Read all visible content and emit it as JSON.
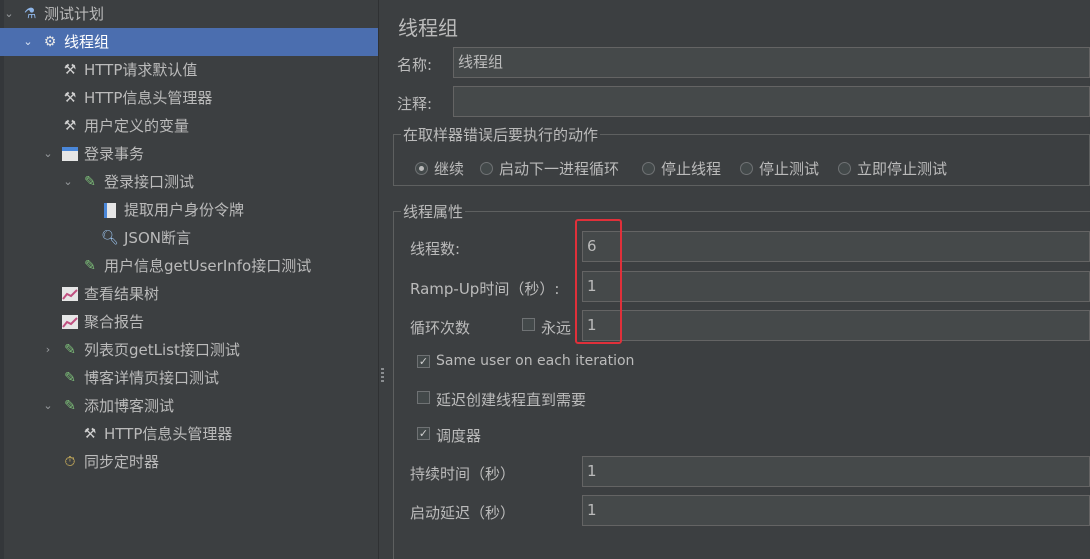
{
  "tree": {
    "items": [
      {
        "label": "测试计划",
        "icon": "flask-icon",
        "expanded": true
      },
      {
        "label": "线程组",
        "icon": "gear-icon",
        "expanded": true,
        "selected": true
      },
      {
        "label": "HTTP请求默认值",
        "icon": "wrench-icon"
      },
      {
        "label": "HTTP信息头管理器",
        "icon": "wrench-icon"
      },
      {
        "label": "用户定义的变量",
        "icon": "wrench-icon"
      },
      {
        "label": "登录事务",
        "icon": "transaction-icon",
        "expanded": true
      },
      {
        "label": "登录接口测试",
        "icon": "pipette-icon",
        "expanded": true
      },
      {
        "label": "提取用户身份令牌",
        "icon": "extractor-icon"
      },
      {
        "label": "JSON断言",
        "icon": "magnifier-icon"
      },
      {
        "label": "用户信息getUserInfo接口测试",
        "icon": "pipette-icon"
      },
      {
        "label": "查看结果树",
        "icon": "graph-icon"
      },
      {
        "label": "聚合报告",
        "icon": "graph-icon"
      },
      {
        "label": "列表页getList接口测试",
        "icon": "pipette-icon",
        "expanded": false
      },
      {
        "label": "博客详情页接口测试",
        "icon": "pipette-icon"
      },
      {
        "label": "添加博客测试",
        "icon": "pipette-icon",
        "expanded": true
      },
      {
        "label": "HTTP信息头管理器",
        "icon": "wrench-icon"
      },
      {
        "label": "同步定时器",
        "icon": "timer-icon"
      }
    ]
  },
  "panel": {
    "title": "线程组",
    "name_label": "名称:",
    "name_value": "线程组",
    "comment_label": "注释:",
    "comment_value": "",
    "error_section_title": "在取样器错误后要执行的动作",
    "error_actions": [
      {
        "label": "继续",
        "selected": true
      },
      {
        "label": "启动下一进程循环",
        "selected": false
      },
      {
        "label": "停止线程",
        "selected": false
      },
      {
        "label": "停止测试",
        "selected": false
      },
      {
        "label": "立即停止测试",
        "selected": false
      }
    ],
    "props_section_title": "线程属性",
    "threads_label": "线程数:",
    "threads_value": "6",
    "rampup_label": "Ramp-Up时间（秒）:",
    "rampup_value": "1",
    "loop_label": "循环次数",
    "forever_label": "永远",
    "forever_checked": false,
    "loop_value": "1",
    "same_user_label": "Same user on each iteration",
    "same_user_checked": true,
    "delay_label": "延迟创建线程直到需要",
    "delay_checked": false,
    "scheduler_label": "调度器",
    "scheduler_checked": true,
    "duration_label": "持续时间（秒）",
    "duration_value": "1",
    "startup_label": "启动延迟（秒）",
    "startup_value": "1"
  },
  "colors": {
    "selection": "#4b6eaf",
    "highlight": "#e0303a",
    "background": "#3c3f41"
  }
}
